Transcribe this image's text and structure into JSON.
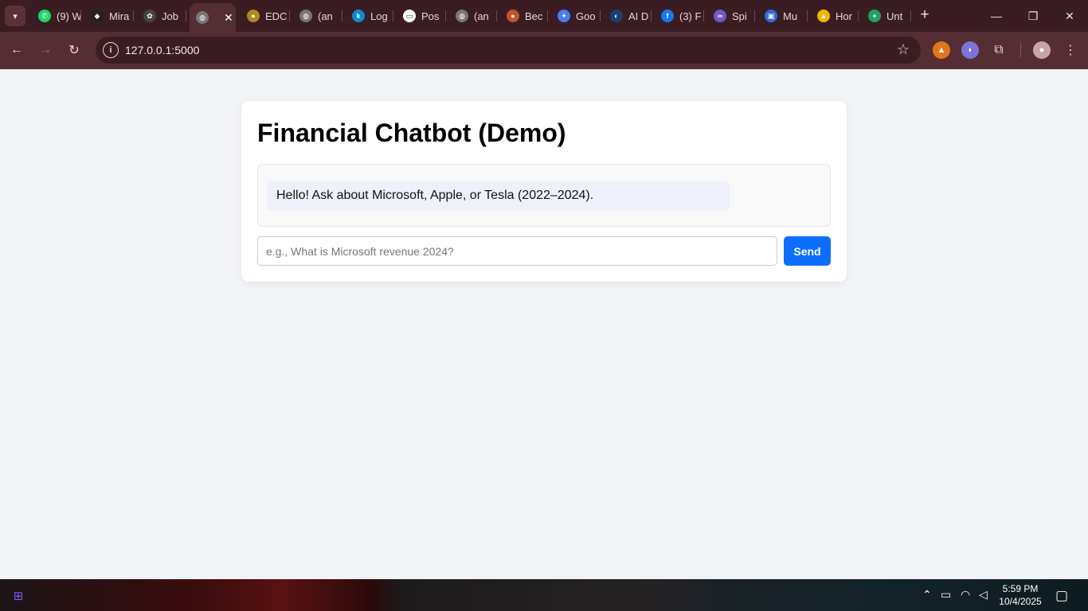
{
  "browser": {
    "tabs": [
      {
        "label": "(9) W",
        "icon": "whatsapp-icon",
        "color": "#25d366",
        "glyph": "✆"
      },
      {
        "label": "Mira",
        "icon": "mira-icon",
        "color": "#222222",
        "glyph": "◆"
      },
      {
        "label": "Job",
        "icon": "openai-icon",
        "color": "#444444",
        "glyph": "✿"
      },
      {
        "label": "",
        "icon": "globe-icon",
        "color": "#777777",
        "glyph": "◍",
        "active": true
      },
      {
        "label": "EDC",
        "icon": "edc-icon",
        "color": "#b08a1e",
        "glyph": "●"
      },
      {
        "label": "(an",
        "icon": "globe-icon",
        "color": "#777777",
        "glyph": "◍"
      },
      {
        "label": "Log",
        "icon": "k-icon",
        "color": "#0a8ad6",
        "glyph": "k"
      },
      {
        "label": "Pos",
        "icon": "post-icon",
        "color": "#ffffff",
        "glyph": "▭"
      },
      {
        "label": "(an",
        "icon": "globe-icon",
        "color": "#777777",
        "glyph": "◍"
      },
      {
        "label": "Bec",
        "icon": "bec-icon",
        "color": "#c4542b",
        "glyph": "●"
      },
      {
        "label": "Goo",
        "icon": "gemini-icon",
        "color": "#4a7bf7",
        "glyph": "✦"
      },
      {
        "label": "AI D",
        "icon": "ai-icon",
        "color": "#1f3d73",
        "glyph": "◐"
      },
      {
        "label": "(3) F",
        "icon": "facebook-icon",
        "color": "#1877f2",
        "glyph": "f"
      },
      {
        "label": "Spi",
        "icon": "bike-icon",
        "color": "#6d5acb",
        "glyph": "∞"
      },
      {
        "label": "Mu",
        "icon": "contact-icon",
        "color": "#2b6ed9",
        "glyph": "▣"
      },
      {
        "label": "Hor",
        "icon": "drive-icon",
        "color": "#f4b400",
        "glyph": "▲"
      },
      {
        "label": "Unt",
        "icon": "sheets-icon",
        "color": "#1ea362",
        "glyph": "+"
      }
    ],
    "url": "127.0.0.1:5000"
  },
  "chat": {
    "title": "Financial Chatbot (Demo)",
    "greeting": "Hello! Ask about Microsoft, Apple, or Tesla (2022–2024).",
    "placeholder": "e.g., What is Microsoft revenue 2024?",
    "send_label": "Send"
  },
  "taskbar": {
    "time": "5:59 PM",
    "date": "10/4/2025"
  },
  "colors": {
    "accent": "#0d6efd",
    "chrome_dark": "#3a1d22",
    "chrome_toolbar": "#552e34"
  }
}
